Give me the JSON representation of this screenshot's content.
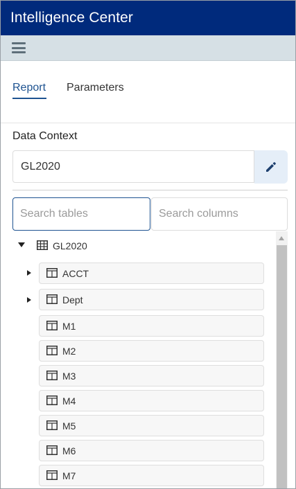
{
  "app": {
    "title": "Intelligence Center"
  },
  "menubar": {
    "menu_icon": "hamburger-icon"
  },
  "tabs": [
    {
      "label": "Report",
      "active": true
    },
    {
      "label": "Parameters",
      "active": false
    }
  ],
  "data_context": {
    "label": "Data Context",
    "value": "GL2020",
    "edit_icon": "pencil-icon"
  },
  "search": {
    "tables_placeholder": "Search tables",
    "columns_placeholder": "Search columns"
  },
  "tree": {
    "root": {
      "label": "GL2020",
      "expanded": true,
      "icon": "database-table-icon"
    },
    "tables": [
      {
        "label": "ACCT",
        "expandable": true,
        "icon": "table-icon"
      },
      {
        "label": "Dept",
        "expandable": true,
        "icon": "table-icon"
      },
      {
        "label": "M1",
        "expandable": false,
        "icon": "table-icon"
      },
      {
        "label": "M2",
        "expandable": false,
        "icon": "table-icon"
      },
      {
        "label": "M3",
        "expandable": false,
        "icon": "table-icon"
      },
      {
        "label": "M4",
        "expandable": false,
        "icon": "table-icon"
      },
      {
        "label": "M5",
        "expandable": false,
        "icon": "table-icon"
      },
      {
        "label": "M6",
        "expandable": false,
        "icon": "table-icon"
      },
      {
        "label": "M7",
        "expandable": false,
        "icon": "table-icon"
      }
    ]
  },
  "colors": {
    "header_bg": "#002a7c",
    "menubar_bg": "#d6e0e5",
    "accent": "#1d5290",
    "edit_button_bg": "#e5eef8"
  }
}
